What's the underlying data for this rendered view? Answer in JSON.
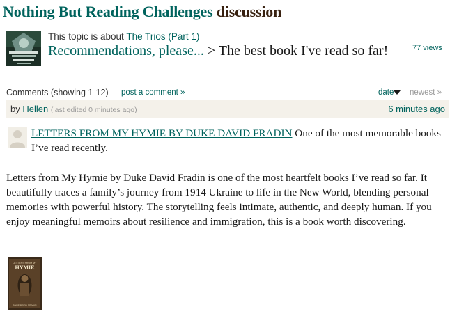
{
  "header": {
    "group_name": "Nothing But Reading Challenges",
    "suffix": "discussion"
  },
  "topic": {
    "intro_prefix": "This topic is about",
    "book_link": "The Trios (Part 1)",
    "folder_link": "Recommendations, please...",
    "separator": ">",
    "title": "The best book I've read so far!",
    "views": "77 views"
  },
  "comments_bar": {
    "label": "Comments",
    "showing": "(showing 1-12)",
    "post_link": "post a comment »",
    "sort_date": "date",
    "sort_newest": "newest »"
  },
  "comment": {
    "by": "by",
    "author": "Hellen",
    "edited": "(last edited 0 minutes ago)",
    "time_ago": "6 minutes ago",
    "link_text": "LETTERS FROM MY HYMIE BY DUKE DAVID FRADIN",
    "lead_text": "One of the most memorable books I’ve read recently.",
    "paragraph": "Letters from My Hymie by Duke David Fradin is one of the most heartfelt books I’ve read so far. It beautifully traces a family’s journey from 1914 Ukraine to life in the New World, blending personal memories with powerful history. The storytelling feels intimate, authentic, and deeply human. If you enjoy meaningful memoirs about resilience and immigration, this is a book worth discovering.",
    "cover_title": "LETTERS FROM MY",
    "cover_big": "HYMIE",
    "cover_author": "DUKE DAVID FRADIN"
  },
  "colors": {
    "link": "#00635d",
    "brown": "#382110",
    "strip": "#f4f1ea"
  }
}
